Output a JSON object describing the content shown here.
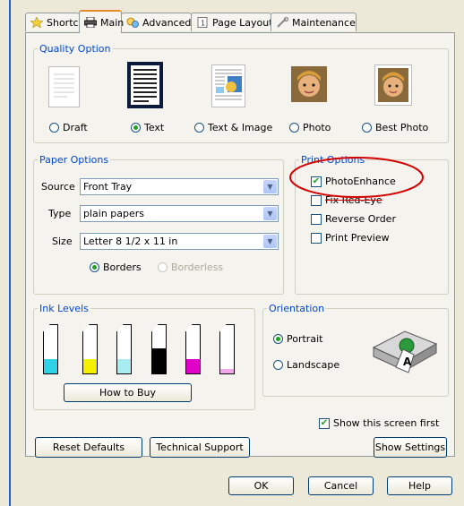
{
  "tabs": [
    {
      "label": "Shortcuts",
      "icon": "star-icon"
    },
    {
      "label": "Main",
      "icon": "printer-icon"
    },
    {
      "label": "Advanced",
      "icon": "gears-icon"
    },
    {
      "label": "Page Layout",
      "icon": "page-layout-icon"
    },
    {
      "label": "Maintenance",
      "icon": "wrench-icon"
    }
  ],
  "quality": {
    "title": "Quality Option",
    "options": [
      {
        "label": "Draft",
        "selected": false
      },
      {
        "label": "Text",
        "selected": true
      },
      {
        "label": "Text & Image",
        "selected": false
      },
      {
        "label": "Photo",
        "selected": false
      },
      {
        "label": "Best Photo",
        "selected": false
      }
    ]
  },
  "paper": {
    "title": "Paper Options",
    "source_label": "Source",
    "source_value": "Front Tray",
    "type_label": "Type",
    "type_value": "plain papers",
    "size_label": "Size",
    "size_value": "Letter 8 1/2 x 11 in",
    "borders_label": "Borders",
    "borderless_label": "Borderless",
    "borders_selected": true
  },
  "print_options": {
    "title": "Print Options",
    "items": [
      {
        "label": "PhotoEnhance",
        "checked": true
      },
      {
        "label": "Fix Red-Eye",
        "checked": false
      },
      {
        "label": "Reverse Order",
        "checked": false
      },
      {
        "label": "Print Preview",
        "checked": false
      }
    ]
  },
  "ink": {
    "title": "Ink Levels",
    "cartridges": [
      {
        "color": "#2fd3e8",
        "level": 0.35
      },
      {
        "color": "#f4f000",
        "level": 0.35
      },
      {
        "color": "#a8eef0",
        "level": 0.35
      },
      {
        "color": "#000000",
        "level": 0.6
      },
      {
        "color": "#e000c8",
        "level": 0.35
      },
      {
        "color": "#f0a8e8",
        "level": 0.1
      }
    ],
    "how_to_buy": "How to Buy"
  },
  "orientation": {
    "title": "Orientation",
    "portrait": "Portrait",
    "landscape": "Landscape",
    "portrait_selected": true
  },
  "show_screen_first": {
    "label": "Show this screen first",
    "checked": true
  },
  "buttons": {
    "reset_defaults": "Reset Defaults",
    "technical_support": "Technical Support",
    "show_settings": "Show Settings",
    "ok": "OK",
    "cancel": "Cancel",
    "help": "Help"
  },
  "colors": {
    "accent_blue": "#0046d5",
    "highlight_red": "#d40000"
  }
}
